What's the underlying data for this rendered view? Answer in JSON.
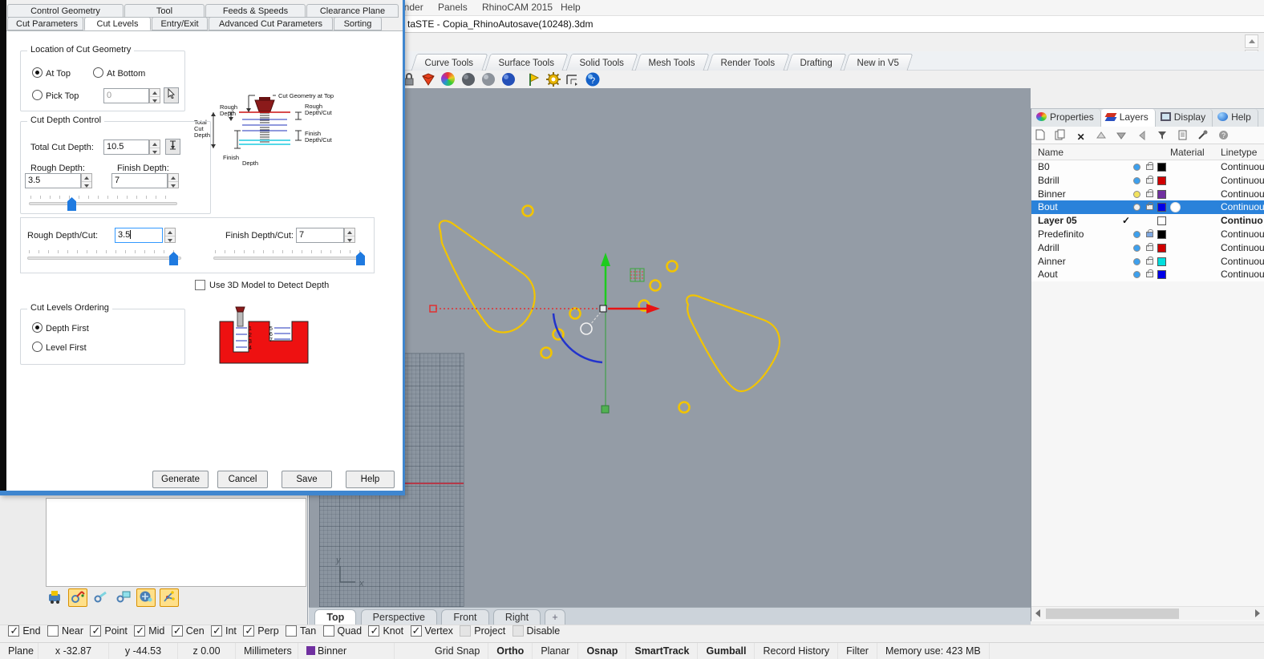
{
  "menubar": {
    "items": [
      {
        "label": "ender"
      },
      {
        "label": "Panels"
      },
      {
        "label": "RhinoCAM 2015"
      },
      {
        "label": "Help"
      }
    ]
  },
  "titlebar": {
    "document": "taSTE - Copia_RhinoAutosave(10248).3dm"
  },
  "toolbar_tabs": {
    "items": [
      {
        "label": "Curve Tools"
      },
      {
        "label": "Surface Tools"
      },
      {
        "label": "Solid Tools"
      },
      {
        "label": "Mesh Tools"
      },
      {
        "label": "Render Tools"
      },
      {
        "label": "Drafting"
      },
      {
        "label": "New in V5"
      }
    ]
  },
  "dialog": {
    "tabs_row1": [
      {
        "label": "Control Geometry"
      },
      {
        "label": "Tool"
      },
      {
        "label": "Feeds & Speeds"
      },
      {
        "label": "Clearance Plane"
      }
    ],
    "tabs_row2": [
      {
        "label": "Cut Parameters"
      },
      {
        "label": "Cut Levels"
      },
      {
        "label": "Entry/Exit"
      },
      {
        "label": "Advanced Cut Parameters"
      },
      {
        "label": "Sorting"
      }
    ],
    "location": {
      "title": "Location of Cut Geometry",
      "at_top": "At Top",
      "at_bottom": "At Bottom",
      "pick_top": "Pick Top",
      "pick_value": "0"
    },
    "diagram": {
      "cut_geometry_at_top": "Cut Geometry at Top",
      "rough_l1": "Rough",
      "rough_l2": "Depth",
      "total_l1": "Total",
      "total_l2": "Cut",
      "total_l3": "Depth",
      "finish_l1": "Finish",
      "finish_l2": "Depth",
      "rough_cut_l1": "Rough",
      "rough_cut_l2": "Depth/Cut",
      "finish_cut_l1": "Finish",
      "finish_cut_l2": "Depth/Cut"
    },
    "cut_depth": {
      "title": "Cut Depth Control",
      "total_label": "Total Cut Depth:",
      "total_value": "10.5",
      "rough_label": "Rough Depth:",
      "rough_value": "3.5",
      "finish_label": "Finish Depth:",
      "finish_value": "7"
    },
    "per_cut": {
      "rough_label": "Rough Depth/Cut:",
      "rough_value": "3.5",
      "finish_label": "Finish Depth/Cut:",
      "finish_value": "7"
    },
    "use_3d_label": "Use 3D Model to Detect Depth",
    "ordering": {
      "title": "Cut Levels Ordering",
      "depth_first": "Depth First",
      "level_first": "Level First",
      "levels_left": [
        "1",
        "2",
        "3",
        "4"
      ],
      "levels_right": [
        "5",
        "6",
        "7"
      ]
    },
    "buttons": {
      "generate": "Generate",
      "cancel": "Cancel",
      "save": "Save",
      "help": "Help"
    }
  },
  "right_panel": {
    "tabs": [
      {
        "label": "Properties"
      },
      {
        "label": "Layers"
      },
      {
        "label": "Display"
      },
      {
        "label": "Help"
      }
    ],
    "columns": {
      "name": "Name",
      "material": "Material",
      "linetype": "Linetype"
    },
    "current_mark": "✓",
    "layers": [
      {
        "name": "B0",
        "swatch": "#000000",
        "linetype": "Continuou",
        "bulb": "#3da0ee",
        "locked": false
      },
      {
        "name": "Bdrill",
        "swatch": "#d00000",
        "linetype": "Continuou",
        "bulb": "#3da0ee",
        "locked": false
      },
      {
        "name": "Binner",
        "swatch": "#7030a0",
        "linetype": "Continuou",
        "bulb": "#f2e25e",
        "locked": false
      },
      {
        "name": "Bout",
        "swatch": "#0000e8",
        "linetype": "Continuou",
        "bulb": "#f0f0f0",
        "locked": false,
        "selected": true,
        "material_dot": true
      },
      {
        "name": "Layer 05",
        "swatch": "#ffffff",
        "linetype": "Continuo",
        "bulb": null,
        "locked": null,
        "current": true
      },
      {
        "name": "Predefinito",
        "swatch": "#000000",
        "linetype": "Continuou",
        "bulb": "#3da0ee",
        "locked": true
      },
      {
        "name": "Adrill",
        "swatch": "#d00000",
        "linetype": "Continuou",
        "bulb": "#3da0ee",
        "locked": false
      },
      {
        "name": "Ainner",
        "swatch": "#00dede",
        "linetype": "Continuou",
        "bulb": "#3da0ee",
        "locked": false
      },
      {
        "name": "Aout",
        "swatch": "#0000e8",
        "linetype": "Continuou",
        "bulb": "#3da0ee",
        "locked": false
      }
    ]
  },
  "viewport": {
    "tabs": [
      {
        "label": "Top"
      },
      {
        "label": "Perspective"
      },
      {
        "label": "Front"
      },
      {
        "label": "Right"
      },
      {
        "label": "+"
      }
    ],
    "axis": {
      "x": "x",
      "y": "y"
    }
  },
  "osnap": {
    "items": [
      {
        "label": "End",
        "checked": true
      },
      {
        "label": "Near",
        "checked": false
      },
      {
        "label": "Point",
        "checked": true
      },
      {
        "label": "Mid",
        "checked": true
      },
      {
        "label": "Cen",
        "checked": true
      },
      {
        "label": "Int",
        "checked": true
      },
      {
        "label": "Perp",
        "checked": true
      },
      {
        "label": "Tan",
        "checked": false
      },
      {
        "label": "Quad",
        "checked": false
      },
      {
        "label": "Knot",
        "checked": true
      },
      {
        "label": "Vertex",
        "checked": true
      },
      {
        "label": "Project",
        "checked": false,
        "disabled": true
      },
      {
        "label": "Disable",
        "checked": false,
        "disabled": true
      }
    ]
  },
  "statusbar": {
    "cplane": "Plane",
    "x": "x -32.87",
    "y": "y -44.53",
    "z": "z 0.00",
    "units": "Millimeters",
    "layer_name": "Binner",
    "layer_color": "#7030a0",
    "toggles": [
      {
        "label": "Grid Snap",
        "bold": false
      },
      {
        "label": "Ortho",
        "bold": true
      },
      {
        "label": "Planar",
        "bold": false
      },
      {
        "label": "Osnap",
        "bold": true
      },
      {
        "label": "SmartTrack",
        "bold": true
      },
      {
        "label": "Gumball",
        "bold": true
      },
      {
        "label": "Record History",
        "bold": false
      },
      {
        "label": "Filter",
        "bold": false
      }
    ],
    "memory": "Memory use: 423 MB"
  }
}
